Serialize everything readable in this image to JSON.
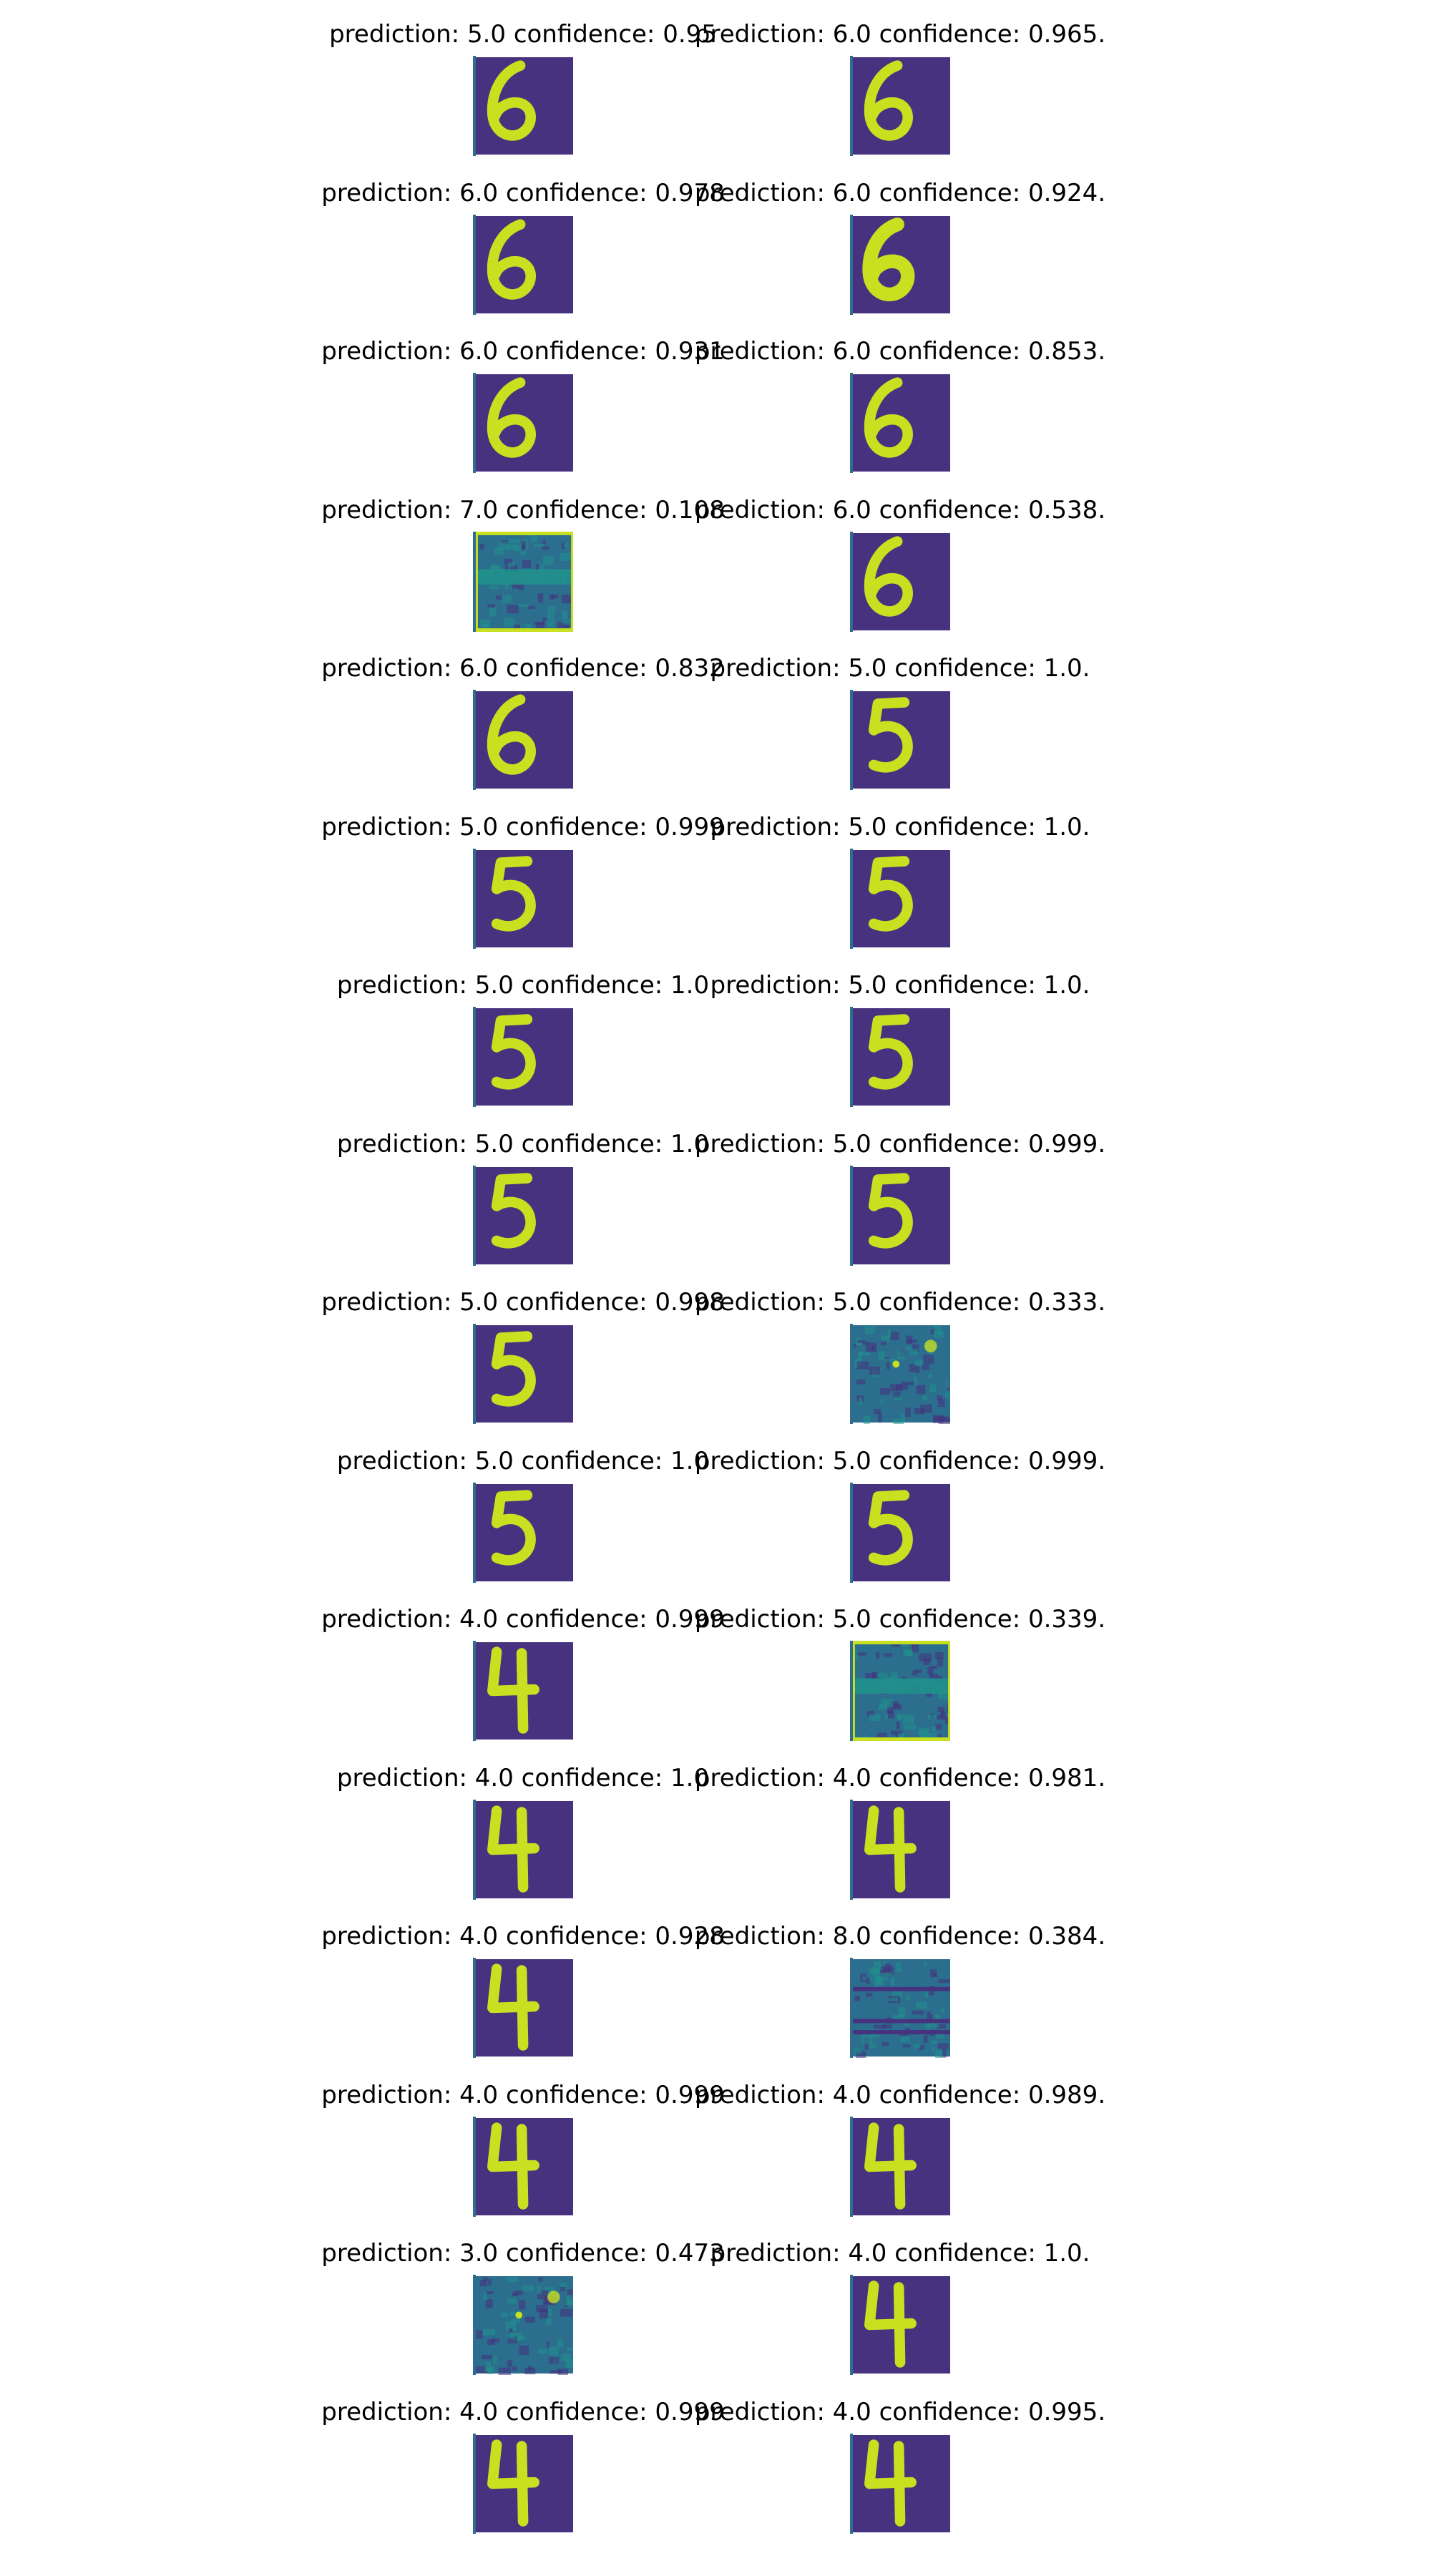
{
  "colors": {
    "background_dark": "#46327e",
    "background_noise": "#2c6e8e",
    "stroke_yellow": "#c8e020",
    "edge_teal": "#21918c"
  },
  "panels": [
    {
      "title": "prediction: 5.0 confidence: 0.95",
      "digit": "6",
      "style": "clean"
    },
    {
      "title": "prediction: 6.0 confidence: 0.965.",
      "digit": "6",
      "style": "clean"
    },
    {
      "title": "prediction: 6.0 confidence: 0.978",
      "digit": "6",
      "style": "clean"
    },
    {
      "title": "prediction: 6.0 confidence: 0.924.",
      "digit": "6",
      "style": "bold"
    },
    {
      "title": "prediction: 6.0 confidence: 0.931",
      "digit": "6",
      "style": "clean"
    },
    {
      "title": "prediction: 6.0 confidence: 0.853.",
      "digit": "6",
      "style": "clean"
    },
    {
      "title": "prediction: 7.0 confidence: 0.108",
      "digit": "",
      "style": "noise-stripe"
    },
    {
      "title": "prediction: 6.0 confidence: 0.538.",
      "digit": "6",
      "style": "clean"
    },
    {
      "title": "prediction: 6.0 confidence: 0.832",
      "digit": "6",
      "style": "clean"
    },
    {
      "title": "prediction: 5.0 confidence: 1.0.",
      "digit": "5",
      "style": "clean"
    },
    {
      "title": "prediction: 5.0 confidence: 0.999",
      "digit": "5",
      "style": "clean"
    },
    {
      "title": "prediction: 5.0 confidence: 1.0.",
      "digit": "5",
      "style": "clean"
    },
    {
      "title": "prediction: 5.0 confidence: 1.0",
      "digit": "5",
      "style": "clean"
    },
    {
      "title": "prediction: 5.0 confidence: 1.0.",
      "digit": "5",
      "style": "clean"
    },
    {
      "title": "prediction: 5.0 confidence: 1.0",
      "digit": "5",
      "style": "clean"
    },
    {
      "title": "prediction: 5.0 confidence: 0.999.",
      "digit": "5",
      "style": "clean"
    },
    {
      "title": "prediction: 5.0 confidence: 0.998",
      "digit": "5",
      "style": "clean"
    },
    {
      "title": "prediction: 5.0 confidence: 0.333.",
      "digit": "",
      "style": "noise"
    },
    {
      "title": "prediction: 5.0 confidence: 1.0",
      "digit": "5",
      "style": "clean"
    },
    {
      "title": "prediction: 5.0 confidence: 0.999.",
      "digit": "5",
      "style": "clean"
    },
    {
      "title": "prediction: 4.0 confidence: 0.999",
      "digit": "4",
      "style": "clean"
    },
    {
      "title": "prediction: 5.0 confidence: 0.339.",
      "digit": "",
      "style": "noise-stripe"
    },
    {
      "title": "prediction: 4.0 confidence: 1.0",
      "digit": "4",
      "style": "clean"
    },
    {
      "title": "prediction: 4.0 confidence: 0.981.",
      "digit": "4",
      "style": "clean"
    },
    {
      "title": "prediction: 4.0 confidence: 0.928",
      "digit": "4",
      "style": "clean"
    },
    {
      "title": "prediction: 8.0 confidence: 0.384.",
      "digit": "",
      "style": "noise-lines"
    },
    {
      "title": "prediction: 4.0 confidence: 0.999",
      "digit": "4",
      "style": "clean"
    },
    {
      "title": "prediction: 4.0 confidence: 0.989.",
      "digit": "4",
      "style": "clean"
    },
    {
      "title": "prediction: 3.0 confidence: 0.473",
      "digit": "",
      "style": "noise"
    },
    {
      "title": "prediction: 4.0 confidence: 1.0.",
      "digit": "4",
      "style": "clean"
    },
    {
      "title": "prediction: 4.0 confidence: 0.999",
      "digit": "4",
      "style": "clean"
    },
    {
      "title": "prediction: 4.0 confidence: 0.995.",
      "digit": "4",
      "style": "clean"
    }
  ]
}
